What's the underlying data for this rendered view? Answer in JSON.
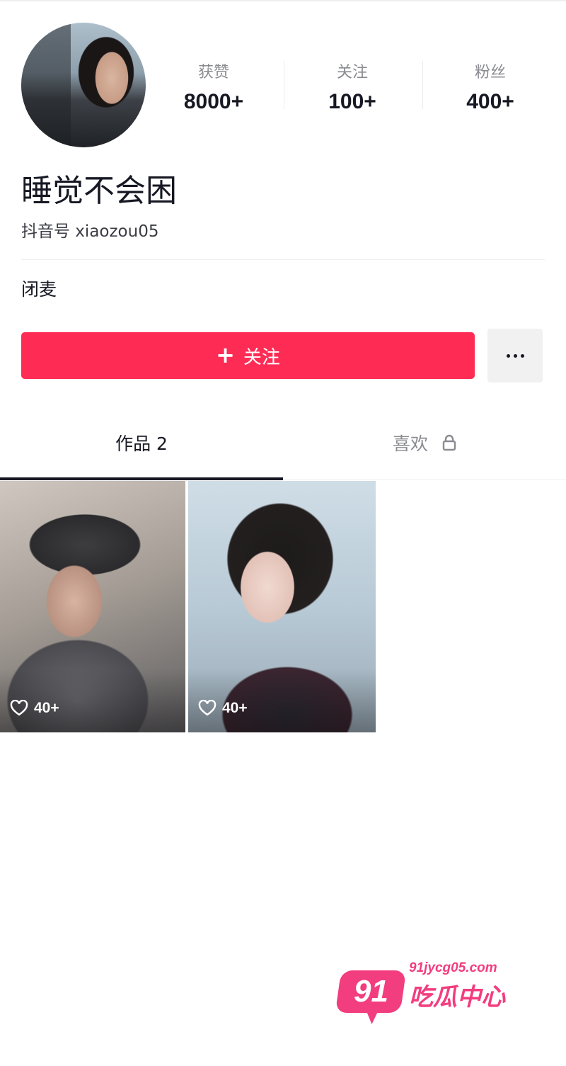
{
  "profile": {
    "nickname": "睡觉不会困",
    "account_id": "抖音号 xiaozou05",
    "bio": "闭麦"
  },
  "stats": {
    "likes_label": "获赞",
    "likes_value": "8000+",
    "following_label": "关注",
    "following_value": "100+",
    "followers_label": "粉丝",
    "followers_value": "400+"
  },
  "actions": {
    "follow_label": "关注",
    "follow_icon": "plus-icon",
    "more_icon": "more-icon"
  },
  "tabs": [
    {
      "label": "作品 2",
      "active": true
    },
    {
      "label": "喜欢",
      "active": false,
      "icon": "lock-icon"
    }
  ],
  "videos": [
    {
      "likes": "40+"
    },
    {
      "likes": "40+"
    }
  ],
  "watermark": {
    "badge": "91",
    "domain": "91jycg05.com",
    "text": "吃瓜中心"
  },
  "colors": {
    "accent": "#fe2c55",
    "watermark": "#f23d7f"
  }
}
